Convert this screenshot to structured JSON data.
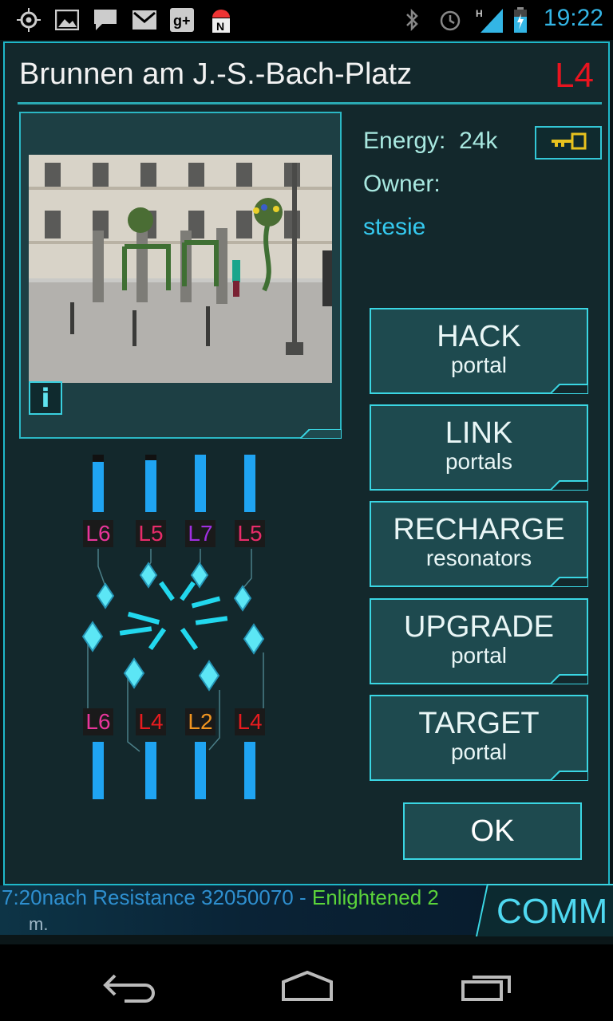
{
  "status_bar": {
    "time": "19:22",
    "left_icons": [
      "gps-icon",
      "gallery-icon",
      "chat-icon",
      "gmail-icon",
      "google-plus-icon",
      "android-debug-icon"
    ],
    "right_icons": [
      "bluetooth-icon",
      "alarm-icon",
      "signal-icon",
      "battery-icon"
    ]
  },
  "portal": {
    "title": "Brunnen am J.-S.-Bach-Platz",
    "level": "L4",
    "energy_label": "Energy:",
    "energy_value": "24k",
    "owner_label": "Owner:",
    "owner_name": "stesie",
    "info_button": "i"
  },
  "actions": [
    {
      "main": "HACK",
      "sub": "portal"
    },
    {
      "main": "LINK",
      "sub": "portals"
    },
    {
      "main": "RECHARGE",
      "sub": "resonators"
    },
    {
      "main": "UPGRADE",
      "sub": "portal"
    },
    {
      "main": "TARGET",
      "sub": "portal"
    }
  ],
  "ok_button": "OK",
  "resonators": {
    "top": [
      {
        "label": "L6",
        "color": "#e8359a",
        "fill": 0.88
      },
      {
        "label": "L5",
        "color": "#e82c6a",
        "fill": 0.9
      },
      {
        "label": "L7",
        "color": "#a02fe0",
        "fill": 1.0
      },
      {
        "label": "L5",
        "color": "#e82c6a",
        "fill": 1.0
      }
    ],
    "bottom": [
      {
        "label": "L6",
        "color": "#e8359a",
        "fill": 1.0
      },
      {
        "label": "L4",
        "color": "#e81b1f",
        "fill": 1.0
      },
      {
        "label": "L2",
        "color": "#f19420",
        "fill": 1.0
      },
      {
        "label": "L4",
        "color": "#e81b1f",
        "fill": 1.0
      }
    ]
  },
  "comm": {
    "ticker_prefix": "7:20nach",
    "ticker_resistance": "Resistance 32050070",
    "ticker_sep": " - ",
    "ticker_enlightened": "Enlightened 2",
    "ticker_line2": "m.",
    "button_label": "COMM"
  },
  "nav_bar": [
    "back-icon",
    "home-icon",
    "recent-apps-icon"
  ],
  "colors": {
    "accent": "#3ad6e3",
    "panel": "#13282c",
    "level_red": "#e8141f",
    "owner_blue": "#35c9ef"
  }
}
